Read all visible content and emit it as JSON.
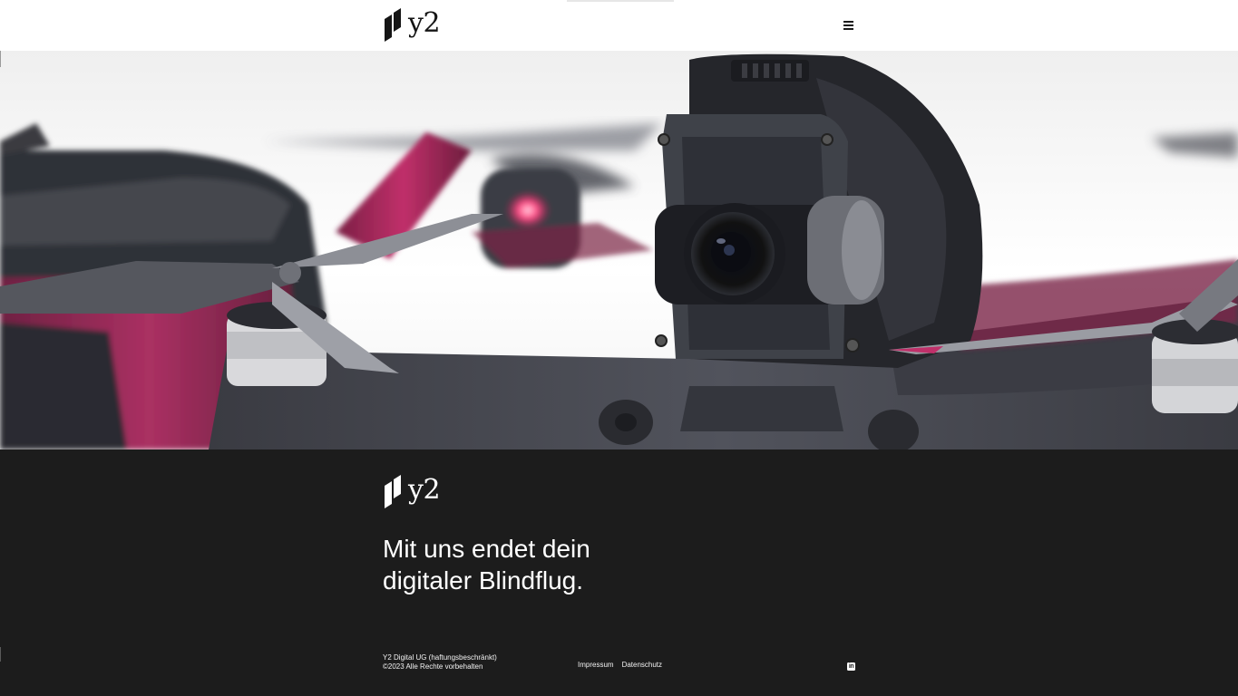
{
  "header": {
    "logo_text": "y2"
  },
  "footer": {
    "logo_text": "y2",
    "tagline": "Mit uns endet dein digitaler Blindflug.",
    "company_name": "Y2 Digital UG (haftungsbeschränkt)",
    "copyright": "©2023 Alle Rechte vorbehalten",
    "links": {
      "impressum": "Impressum",
      "datenschutz": "Datenschutz"
    },
    "social": {
      "linkedin_glyph": "in"
    }
  },
  "icons": {
    "menu": "hamburger-menu-icon",
    "linkedin": "linkedin-icon"
  },
  "colors": {
    "footer_background": "#1c1c1c",
    "accent_magenta": "#b5275e",
    "text_light": "#ffffff",
    "text_dark": "#151515"
  }
}
